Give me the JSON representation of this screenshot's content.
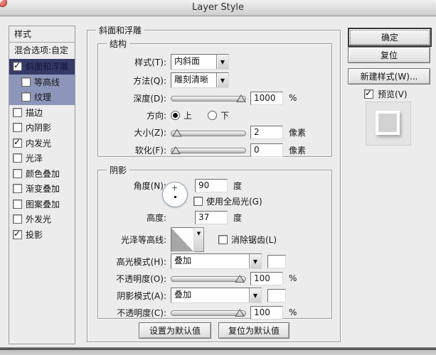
{
  "window": {
    "title": "Layer Style"
  },
  "sidebar": {
    "header": "样式",
    "blend_option": "混合选项:自定",
    "items": [
      {
        "label": "斜面和浮雕",
        "checked": true,
        "state": "selected",
        "indent": false
      },
      {
        "label": "等高线",
        "checked": false,
        "state": "highlight",
        "indent": true
      },
      {
        "label": "纹理",
        "checked": false,
        "state": "highlight",
        "indent": true
      },
      {
        "label": "描边",
        "checked": false,
        "state": "",
        "indent": false
      },
      {
        "label": "内阴影",
        "checked": false,
        "state": "",
        "indent": false
      },
      {
        "label": "内发光",
        "checked": true,
        "state": "",
        "indent": false
      },
      {
        "label": "光泽",
        "checked": false,
        "state": "",
        "indent": false
      },
      {
        "label": "颜色叠加",
        "checked": false,
        "state": "",
        "indent": false
      },
      {
        "label": "渐变叠加",
        "checked": false,
        "state": "",
        "indent": false
      },
      {
        "label": "图案叠加",
        "checked": false,
        "state": "",
        "indent": false
      },
      {
        "label": "外发光",
        "checked": false,
        "state": "",
        "indent": false
      },
      {
        "label": "投影",
        "checked": true,
        "state": "",
        "indent": false
      }
    ]
  },
  "panel": {
    "title": "斜面和浮雕",
    "structure": {
      "title": "结构",
      "style": {
        "label": "样式(T):",
        "value": "内斜面"
      },
      "technique": {
        "label": "方法(Q):",
        "value": "雕刻清晰"
      },
      "depth": {
        "label": "深度(D):",
        "value": "1000",
        "unit": "%",
        "slider_pct": 100
      },
      "direction": {
        "label": "方向:",
        "up": "上",
        "down": "下",
        "selected": "up"
      },
      "size": {
        "label": "大小(Z):",
        "value": "2",
        "unit": "像素",
        "slider_pct": 2
      },
      "soften": {
        "label": "软化(F):",
        "value": "0",
        "unit": "像素",
        "slider_pct": 0
      }
    },
    "shading": {
      "title": "阴影",
      "angle": {
        "label": "角度(N):",
        "value": "90",
        "unit": "度"
      },
      "global_light": {
        "label": "使用全局光(G)",
        "checked": false
      },
      "altitude": {
        "label": "高度:",
        "value": "37",
        "unit": "度"
      },
      "gloss_contour": {
        "label": "光泽等高线:"
      },
      "anti_alias": {
        "label": "消除锯齿(L)",
        "checked": false
      },
      "highlight_mode": {
        "label": "高光模式(H):",
        "value": "叠加",
        "swatch": "#ffffff"
      },
      "highlight_opacity": {
        "label": "不透明度(O):",
        "value": "100",
        "unit": "%",
        "slider_pct": 98
      },
      "shadow_mode": {
        "label": "阴影模式(A):",
        "value": "叠加",
        "swatch": "#ffffff"
      },
      "shadow_opacity": {
        "label": "不透明度(C):",
        "value": "100",
        "unit": "%",
        "slider_pct": 98
      }
    },
    "footer": {
      "set_default": "设置为默认值",
      "reset_default": "复位为默认值"
    }
  },
  "actions": {
    "ok": "确定",
    "reset": "复位",
    "new_style": "新建样式(W)...",
    "preview": {
      "label": "预览(V)",
      "checked": true
    }
  },
  "colors": {
    "dialog_bg": "#ececec",
    "selected_item_bg": "#353a68",
    "sub_item_bg": "#8d96ba",
    "highlight_swatch": "#ffffff",
    "shadow_swatch": "#ffffff"
  }
}
